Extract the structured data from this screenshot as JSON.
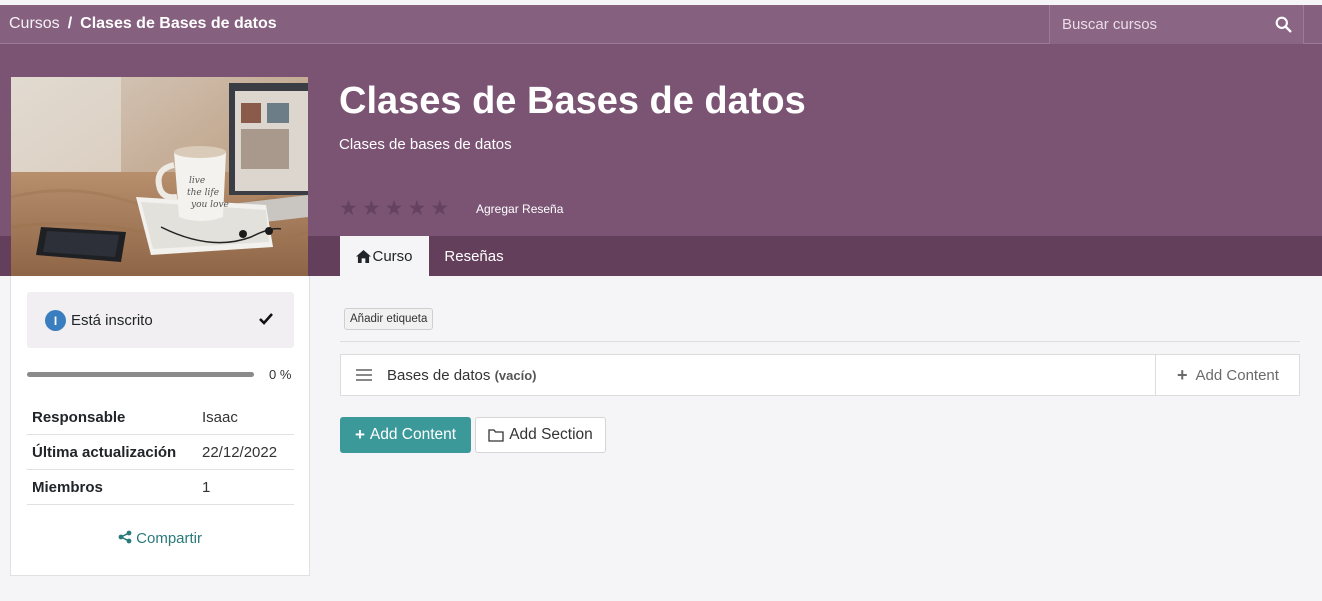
{
  "breadcrumb": {
    "root": "Cursos",
    "separator": "/",
    "current": "Clases de Bases de datos"
  },
  "search": {
    "placeholder": "Buscar cursos",
    "icon": "search-icon"
  },
  "course": {
    "title": "Clases de Bases de datos",
    "subtitle": "Clases de bases de datos",
    "rating_stars": 0,
    "rating_max": 5,
    "review_link": "Agregar Reseña"
  },
  "tabs": [
    {
      "label": "Curso",
      "icon": "home-icon"
    },
    {
      "label": "Reseñas"
    }
  ],
  "sidebar": {
    "enrolled": {
      "badge": "I",
      "label": "Está inscrito"
    },
    "progress": {
      "value": 0,
      "label": "0 %"
    },
    "meta": [
      {
        "key": "Responsable",
        "value": "Isaac"
      },
      {
        "key": "Última actualización",
        "value": "22/12/2022"
      },
      {
        "key": "Miembros",
        "value": "1"
      }
    ],
    "share_label": "Compartir"
  },
  "main": {
    "tag_button": "Añadir etiqueta",
    "section": {
      "name": "Bases de datos",
      "status": "(vacío)",
      "add_label": "Add Content"
    },
    "buttons": {
      "add_content": "Add Content",
      "add_section": "Add Section"
    }
  },
  "colors": {
    "header": "#85607f",
    "hero": "#7b5474",
    "tabs_bar": "#643f5c",
    "primary": "#3c999a",
    "link": "#2a7a7a"
  }
}
